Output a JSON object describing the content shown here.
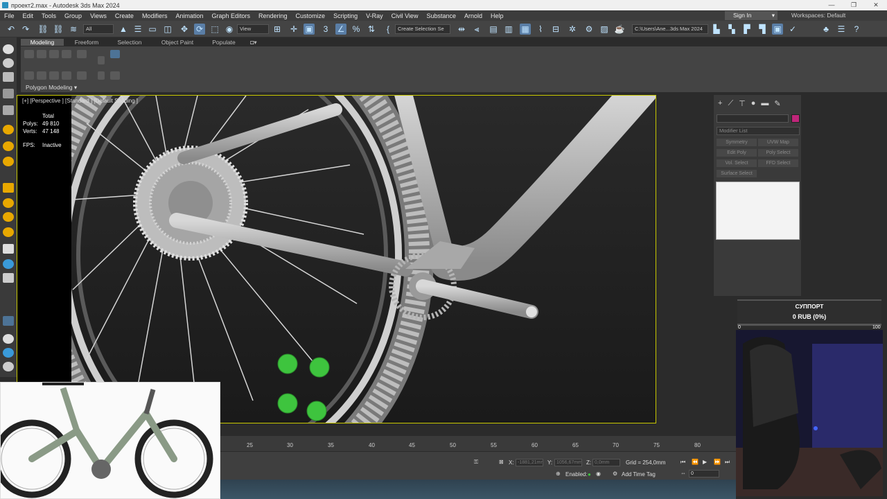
{
  "window": {
    "title": "проект2.max - Autodesk 3ds Max 2024",
    "controls": [
      "—",
      "❐",
      "✕"
    ]
  },
  "menu": [
    "File",
    "Edit",
    "Tools",
    "Group",
    "Views",
    "Create",
    "Modifiers",
    "Animation",
    "Graph Editors",
    "Rendering",
    "Customize",
    "Scripting",
    "V-Ray",
    "Civil View",
    "Substance",
    "Arnold",
    "Help"
  ],
  "account": {
    "signin": "Sign In",
    "workspaces_label": "Workspaces:",
    "workspaces_value": "Default"
  },
  "toolbar": {
    "selection_filter": "All",
    "ref_coord": "View",
    "named_selection": "Create Selection Se",
    "project_path": "C:\\Users\\Ane...3ds Max 2024"
  },
  "ribbon": {
    "tabs": [
      "Modeling",
      "Freeform",
      "Selection",
      "Object Paint",
      "Populate"
    ],
    "active_tab": "Modeling",
    "panel_label": "Polygon Modeling ▾"
  },
  "viewport": {
    "label": "[+] [Perspective ] [Standard ] [Default Shading ]",
    "stats": {
      "header": "Total",
      "polys_label": "Polys:",
      "polys_value": "49 810",
      "verts_label": "Verts:",
      "verts_value": "47 148",
      "fps_label": "FPS:",
      "fps_value": "Inactive"
    }
  },
  "command_panel": {
    "modifier_list": "Modifier List",
    "buttons": [
      "Symmetry",
      "UVW Map",
      "Edit Poly",
      "Poly Select",
      "Vol. Select",
      "FFD Select",
      "Surface Select"
    ],
    "object_color": "#c0267a"
  },
  "donation": {
    "title": "СУППОРТ",
    "amount": "0 RUB (0%)",
    "min": "0",
    "max": "100",
    "progress": 0
  },
  "timeline": {
    "ticks": [
      "25",
      "30",
      "35",
      "40",
      "45",
      "50",
      "55",
      "60",
      "65",
      "70",
      "75",
      "80"
    ]
  },
  "status": {
    "x_label": "X:",
    "x_value": "-1881,21mm",
    "y_label": "Y:",
    "y_value": "1056,67mm",
    "z_label": "Z:",
    "z_value": "0,0mm",
    "grid": "Grid = 254,0mm",
    "enabled_label": "Enabled:",
    "add_time_tag": "Add Time Tag",
    "frame_value": "0"
  },
  "colors": {
    "accent": "#c8c800",
    "viewport_bg": "#222222",
    "marker_green": "#3ec43e"
  }
}
